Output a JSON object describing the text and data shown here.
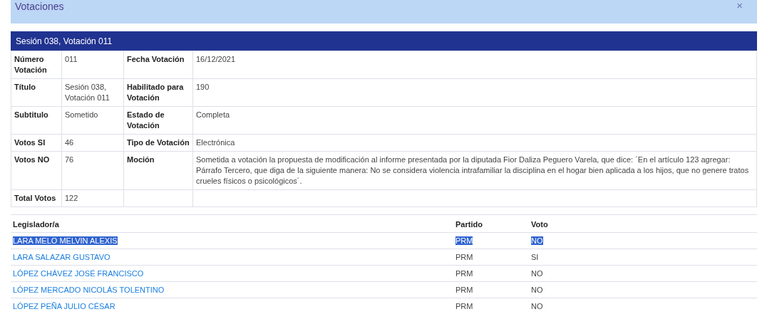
{
  "dialog": {
    "title": "Votaciones",
    "close": "×"
  },
  "vote": {
    "heading": "Sesión 038, Votación 011",
    "rows": [
      [
        {
          "label": "Número Votación",
          "value": "011"
        },
        {
          "label": "Fecha Votación",
          "value": "16/12/2021"
        }
      ],
      [
        {
          "label": "Título",
          "value": "Sesión 038, Votación 011"
        },
        {
          "label": "Habilitado para Votación",
          "value": "190"
        }
      ],
      [
        {
          "label": "Subtitulo",
          "value": "Sometido"
        },
        {
          "label": "Estado de Votación",
          "value": "Completa"
        }
      ],
      [
        {
          "label": "Votos SI",
          "value": "46"
        },
        {
          "label": "Tipo de Votación",
          "value": "Electrónica"
        }
      ],
      [
        {
          "label": "Votos NO",
          "value": "76"
        },
        {
          "label": "Moción",
          "value": "Sometida a votación la propuesta de modificación al informe presentada por la diputada Fior Daliza Peguero Varela, que dice: ´En el artículo 123 agregar: Párrafo Tercero, que diga de la siguiente manera: No se considera violencia intrafamiliar la disciplina en el hogar bien aplicada a los hijos, que no genere tratos crueles físicos o psicológicos´."
        }
      ],
      [
        {
          "label": "Total Votos",
          "value": "122"
        }
      ]
    ]
  },
  "legislators": {
    "columns": [
      "Legislador/a",
      "Partido",
      "Voto"
    ],
    "rows": [
      {
        "name": "LARA MELO MELVIN ALEXIS",
        "party": "PRM",
        "vote": "NO",
        "selected": true
      },
      {
        "name": "LARA SALAZAR GUSTAVO",
        "party": "PRM",
        "vote": "SI",
        "selected": false
      },
      {
        "name": "LÓPEZ CHÁVEZ JOSÉ FRANCISCO",
        "party": "PRM",
        "vote": "NO",
        "selected": false
      },
      {
        "name": "LÓPEZ MERCADO NICOLÁS TOLENTINO",
        "party": "PRM",
        "vote": "NO",
        "selected": false
      },
      {
        "name": "LÓPEZ PEÑA JULIO CÉSAR",
        "party": "PRM",
        "vote": "NO",
        "selected": false
      }
    ]
  }
}
